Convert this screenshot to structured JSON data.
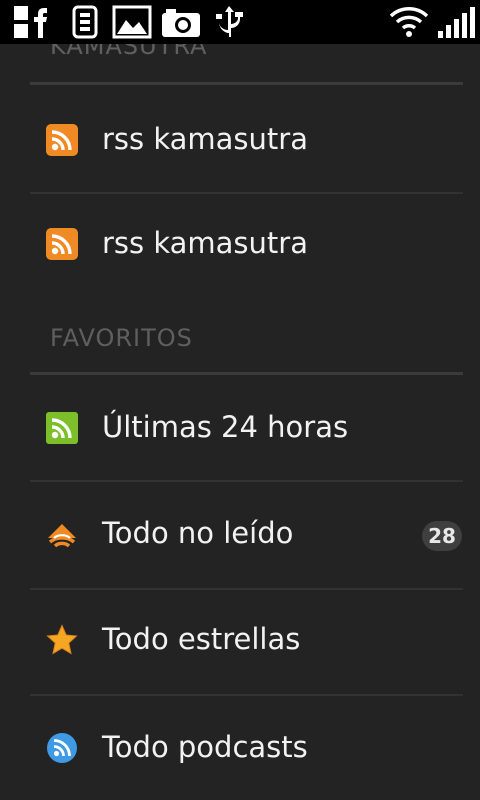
{
  "status_bar": {
    "icons": [
      "facebook-icon",
      "download-icon",
      "gallery-icon",
      "camera-icon",
      "usb-icon"
    ],
    "right_icons": [
      "wifi-icon",
      "signal-icon"
    ]
  },
  "sections": [
    {
      "header": "KAMASUTRA",
      "items": [
        {
          "label": "rss kamasutra",
          "icon": "rss-feed-icon",
          "icon_color": "#f08a24"
        },
        {
          "label": "rss kamasutra",
          "icon": "rss-feed-icon",
          "icon_color": "#f08a24"
        }
      ]
    },
    {
      "header": "FAVORITOS",
      "items": [
        {
          "label": "Últimas 24 horas",
          "icon": "rss-green-icon",
          "icon_color": "#7cbf2a"
        },
        {
          "label": "Todo no leído",
          "icon": "unread-icon",
          "icon_color": "#f08a24",
          "count": "28"
        },
        {
          "label": "Todo estrellas",
          "icon": "star-icon",
          "icon_color": "#f5a623"
        },
        {
          "label": "Todo podcasts",
          "icon": "podcast-icon",
          "icon_color": "#3f9ae6"
        }
      ]
    }
  ],
  "colors": {
    "background": "#232323",
    "header_text": "#5f5f5f",
    "item_text": "#f2f2f2",
    "badge_bg": "#3f3f3f"
  }
}
